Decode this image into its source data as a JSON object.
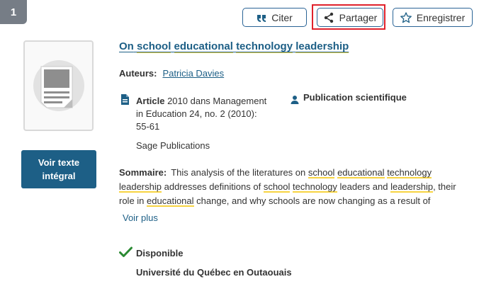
{
  "result": {
    "number": "1",
    "title_parts": [
      "On",
      " ",
      "school",
      " ",
      "educational",
      " ",
      "technology",
      " ",
      "leadership"
    ],
    "authors_label": "Auteurs:",
    "author": "Patricia Davies",
    "article_label": "Article",
    "article_details": " 2010 dans Management in Education 24, no. 2 (2010): 55-61",
    "publisher": "Sage Publications",
    "pub_type": "Publication scientifique",
    "summary_label": "Sommaire:",
    "summary": {
      "p1": "This analysis of the literatures on ",
      "w1": "school",
      "w2": "educational",
      "w3": "technology",
      "w4": "leadership",
      "p2": " addresses definitions of ",
      "w5": "school",
      "w6": "technology",
      "p3": " leaders and ",
      "w7": "leadership",
      "p4": ", their role in ",
      "w8": "educational",
      "p5": " change, and why schools are now changing as a result of"
    },
    "more_label": "Voir plus",
    "availability": "Disponible",
    "library": "Université du Québec en Outaouais"
  },
  "actions": {
    "cite": "Citer",
    "share": "Partager",
    "save": "Enregistrer"
  },
  "fulltext": {
    "line1": "Voir texte",
    "line2": "intégral"
  },
  "colors": {
    "accent": "#1d5f86",
    "highlight": "#f7d442",
    "focus_box": "#e0212b",
    "badge": "#767d86",
    "available": "#2a8a32"
  }
}
